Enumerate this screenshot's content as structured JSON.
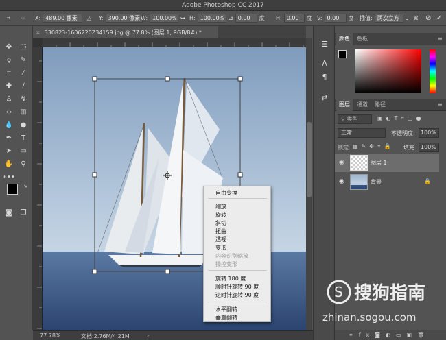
{
  "app": {
    "title": "Adobe Photoshop CC 2017"
  },
  "options": {
    "x_label": "X:",
    "x_value": "489.00 像素",
    "y_label": "Y:",
    "y_value": "390.00 像素",
    "w_label": "W:",
    "w_value": "100.00%",
    "h_label": "H:",
    "h_value": "100.00%",
    "angle_value": "0.00",
    "angle_unit": "度",
    "hskew_label": "H:",
    "hskew_value": "0.00",
    "vskew_label": "V:",
    "vskew_value": "0.00",
    "skew_unit": "度",
    "interp_label": "插值:",
    "interp_value": "两次立方"
  },
  "document": {
    "tab_title": "330823-1606220Z34159.jpg @ 77.8% (图层 1, RGB/8#) *",
    "zoom": "77.78%",
    "doc_info": "文档:2.76M/4.21M"
  },
  "context_menu": {
    "items": [
      {
        "label": "自由变换",
        "enabled": true
      },
      {
        "label": "缩放",
        "enabled": true
      },
      {
        "label": "旋转",
        "enabled": true
      },
      {
        "label": "斜切",
        "enabled": true
      },
      {
        "label": "扭曲",
        "enabled": true
      },
      {
        "label": "透视",
        "enabled": true
      },
      {
        "label": "变形",
        "enabled": true
      },
      {
        "label": "内容识别缩放",
        "enabled": false
      },
      {
        "label": "操控变形",
        "enabled": false
      },
      {
        "label": "旋转 180 度",
        "enabled": true
      },
      {
        "label": "顺时针旋转 90 度",
        "enabled": true
      },
      {
        "label": "逆时针旋转 90 度",
        "enabled": true
      },
      {
        "label": "水平翻转",
        "enabled": true
      },
      {
        "label": "垂直翻转",
        "enabled": true
      }
    ]
  },
  "color_panel": {
    "tab1": "颜色",
    "tab2": "色板"
  },
  "layers_panel": {
    "tab1": "图层",
    "tab2": "通道",
    "tab3": "路径",
    "filter_label": "类型",
    "blend_mode": "正常",
    "opacity_label": "不透明度:",
    "opacity_value": "100%",
    "lock_label": "锁定:",
    "fill_label": "填充:",
    "fill_value": "100%",
    "layers": [
      {
        "name": "图层 1",
        "selected": true
      },
      {
        "name": "背景",
        "selected": false
      }
    ]
  },
  "watermark": {
    "brand": "搜狗指南",
    "url": "zhinan.sogou.com"
  },
  "colors": {
    "accent": "#4a90d9",
    "panel": "#535353",
    "menu": "#ececec"
  }
}
